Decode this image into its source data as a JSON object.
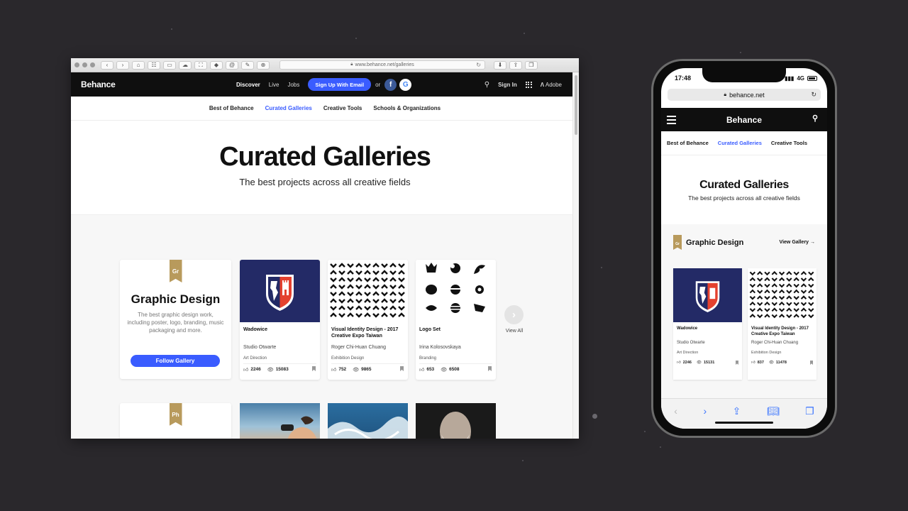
{
  "browser": {
    "url": "www.behance.net/galleries",
    "toolbar_glyphs": [
      "⌂",
      "☷",
      "▭",
      "☁",
      "⛶",
      "◆",
      "@",
      "✎",
      "⊕"
    ]
  },
  "nav": {
    "logo": "Behance",
    "discover": "Discover",
    "live": "Live",
    "jobs": "Jobs",
    "signup": "Sign Up With Email",
    "or": "or",
    "facebook": "f",
    "google": "G",
    "signin": "Sign In",
    "adobe": "Adobe"
  },
  "subnav": [
    "Best of Behance",
    "Curated Galleries",
    "Creative Tools",
    "Schools & Organizations"
  ],
  "hero": {
    "title": "Curated Galleries",
    "subtitle": "The best projects across all creative fields"
  },
  "gallery": {
    "badge": "Gr",
    "title": "Graphic Design",
    "description": "The best graphic design work, including poster, logo, branding, music packaging and more.",
    "follow": "Follow Gallery",
    "view_all": "View All",
    "next_badge": "Ph"
  },
  "projects": [
    {
      "title": "Wadowice",
      "owner": "Studio Otwarte",
      "field": "Art Direction",
      "appreciations": "2246",
      "views": "15083"
    },
    {
      "title": "Visual Identity Design - 2017 Creative Expo Taiwan",
      "owner": "Roger Chi-Huan Chuang",
      "field": "Exhibition Design",
      "appreciations": "752",
      "views": "9865"
    },
    {
      "title": "Logo Set",
      "owner": "Irina Kolosovskaya",
      "field": "Branding",
      "appreciations": "653",
      "views": "6508"
    }
  ],
  "phone": {
    "time": "17:48",
    "network": "4G",
    "url": "behance.net",
    "logo": "Behance",
    "subnav": [
      "Best of Behance",
      "Curated Galleries",
      "Creative Tools"
    ],
    "hero_title": "Curated Galleries",
    "hero_subtitle": "The best projects across all creative fields",
    "gallery_badge": "Gr",
    "gallery_title": "Graphic Design",
    "view_gallery": "View Gallery →",
    "cards": [
      {
        "title": "Wadowice",
        "owner": "Studio Otwarte",
        "field": "Art Direction",
        "appreciations": "2246",
        "views": "15131"
      },
      {
        "title": "Visual Identity Design - 2017 Creative Expo Taiwan",
        "owner": "Roger Chi-Huan Chuang",
        "field": "Exhibition Design",
        "appreciations": "837",
        "views": "11478"
      }
    ]
  },
  "colors": {
    "accent": "#3a5cff",
    "gold": "#b89a5c",
    "navy": "#232a66",
    "red": "#e4412f"
  },
  "icons": [
    "search-icon",
    "apps-grid-icon",
    "thumb-up-icon",
    "eye-icon",
    "bookmark-icon",
    "chevron-right-icon",
    "lock-icon",
    "reload-icon",
    "hamburger-icon",
    "share-icon",
    "book-icon",
    "tabs-icon"
  ]
}
